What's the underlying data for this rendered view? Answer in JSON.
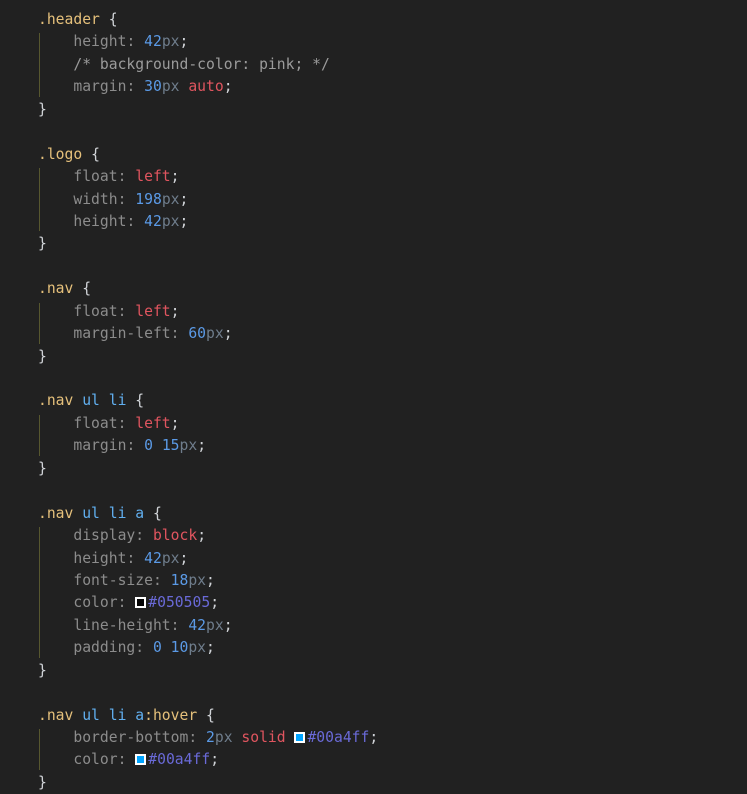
{
  "editor": {
    "language": "css",
    "theme_name": "dark",
    "background_color": "#212121",
    "font_size_px": 15,
    "line_height_px": 22,
    "indent_guide_color": "#57572f"
  },
  "palette": {
    "selector": "#e5c07b",
    "element_selector": "#61afef",
    "property": "#8c8c8c",
    "number": "#5b9ae6",
    "unit": "#6f7d8c",
    "keyword_value": "#e0555f",
    "hex_literal": "#6a6ad8",
    "comment": "#9b9b9b",
    "punctuation": "#d0d3d7"
  },
  "swatches": [
    {
      "name": "color-swatch-050505",
      "hex": "#050505",
      "on_line": 30
    },
    {
      "name": "color-swatch-00a4ff-border",
      "hex": "#00a4ff",
      "on_line": 37
    },
    {
      "name": "color-swatch-00a4ff-color",
      "hex": "#00a4ff",
      "on_line": 38
    }
  ],
  "rules": [
    {
      "selector_text": ".header",
      "declarations": [
        {
          "property": "height",
          "value": "42px"
        },
        {
          "comment": "/* background-color: pink; */"
        },
        {
          "property": "margin",
          "value": "30px auto"
        }
      ]
    },
    {
      "selector_text": ".logo",
      "declarations": [
        {
          "property": "float",
          "value": "left"
        },
        {
          "property": "width",
          "value": "198px"
        },
        {
          "property": "height",
          "value": "42px"
        }
      ]
    },
    {
      "selector_text": ".nav",
      "declarations": [
        {
          "property": "float",
          "value": "left"
        },
        {
          "property": "margin-left",
          "value": "60px"
        }
      ]
    },
    {
      "selector_text": ".nav ul li",
      "declarations": [
        {
          "property": "float",
          "value": "left"
        },
        {
          "property": "margin",
          "value": "0 15px"
        }
      ]
    },
    {
      "selector_text": ".nav ul li a",
      "declarations": [
        {
          "property": "display",
          "value": "block"
        },
        {
          "property": "height",
          "value": "42px"
        },
        {
          "property": "font-size",
          "value": "18px"
        },
        {
          "property": "color",
          "value": "#050505"
        },
        {
          "property": "line-height",
          "value": "42px"
        },
        {
          "property": "padding",
          "value": "0 10px"
        }
      ]
    },
    {
      "selector_text": ".nav ul li a:hover",
      "declarations": [
        {
          "property": "border-bottom",
          "value": "2px solid #00a4ff"
        },
        {
          "property": "color",
          "value": "#00a4ff"
        }
      ]
    }
  ],
  "tokens": {
    "l1_sel": ".header",
    "l1_brace": "{",
    "l2_prop": "height",
    "l2_colon": ": ",
    "l2_num": "42",
    "l2_unit": "px",
    "l2_semi": ";",
    "l3_comment": "/* background-color: pink; */",
    "l4_prop": "margin",
    "l4_colon": ": ",
    "l4_num": "30",
    "l4_unit": "px",
    "l4_space": " ",
    "l4_kw": "auto",
    "l4_semi": ";",
    "l5_brace": "}",
    "l7_sel": ".logo",
    "l7_brace": "{",
    "l8_prop": "float",
    "l8_colon": ": ",
    "l8_kw": "left",
    "l8_semi": ";",
    "l9_prop": "width",
    "l9_colon": ": ",
    "l9_num": "198",
    "l9_unit": "px",
    "l9_semi": ";",
    "l10_prop": "height",
    "l10_colon": ": ",
    "l10_num": "42",
    "l10_unit": "px",
    "l10_semi": ";",
    "l11_brace": "}",
    "l13_sel": ".nav",
    "l13_brace": "{",
    "l14_prop": "float",
    "l14_colon": ": ",
    "l14_kw": "left",
    "l14_semi": ";",
    "l15_prop": "margin-left",
    "l15_colon": ": ",
    "l15_num": "60",
    "l15_unit": "px",
    "l15_semi": ";",
    "l16_brace": "}",
    "l18_sel": ".nav",
    "l18_ul": "ul",
    "l18_li": "li",
    "l18_brace": "{",
    "l19_prop": "float",
    "l19_colon": ": ",
    "l19_kw": "left",
    "l19_semi": ";",
    "l20_prop": "margin",
    "l20_colon": ": ",
    "l20_num0": "0",
    "l20_num1": "15",
    "l20_unit": "px",
    "l20_semi": ";",
    "l21_brace": "}",
    "l23_sel": ".nav",
    "l23_ul": "ul",
    "l23_li": "li",
    "l23_a": "a",
    "l23_brace": "{",
    "l24_prop": "display",
    "l24_colon": ": ",
    "l24_kw": "block",
    "l24_semi": ";",
    "l25_prop": "height",
    "l25_colon": ": ",
    "l25_num": "42",
    "l25_unit": "px",
    "l25_semi": ";",
    "l26_prop": "font-size",
    "l26_colon": ": ",
    "l26_num": "18",
    "l26_unit": "px",
    "l26_semi": ";",
    "l27_prop": "color",
    "l27_colon": ": ",
    "l27_hex": "#050505",
    "l27_semi": ";",
    "l28_prop": "line-height",
    "l28_colon": ": ",
    "l28_num": "42",
    "l28_unit": "px",
    "l28_semi": ";",
    "l29_prop": "padding",
    "l29_colon": ": ",
    "l29_num0": "0",
    "l29_num1": "10",
    "l29_unit": "px",
    "l29_semi": ";",
    "l30_brace": "}",
    "l32_sel": ".nav",
    "l32_ul": "ul",
    "l32_li": "li",
    "l32_a": "a",
    "l32_pseudo": ":hover",
    "l32_brace": "{",
    "l33_prop": "border-bottom",
    "l33_colon": ": ",
    "l33_num": "2",
    "l33_unit": "px",
    "l33_kw": "solid",
    "l33_hex": "#00a4ff",
    "l33_semi": ";",
    "l34_prop": "color",
    "l34_colon": ": ",
    "l34_hex": "#00a4ff",
    "l34_semi": ";",
    "l35_brace": "}"
  }
}
